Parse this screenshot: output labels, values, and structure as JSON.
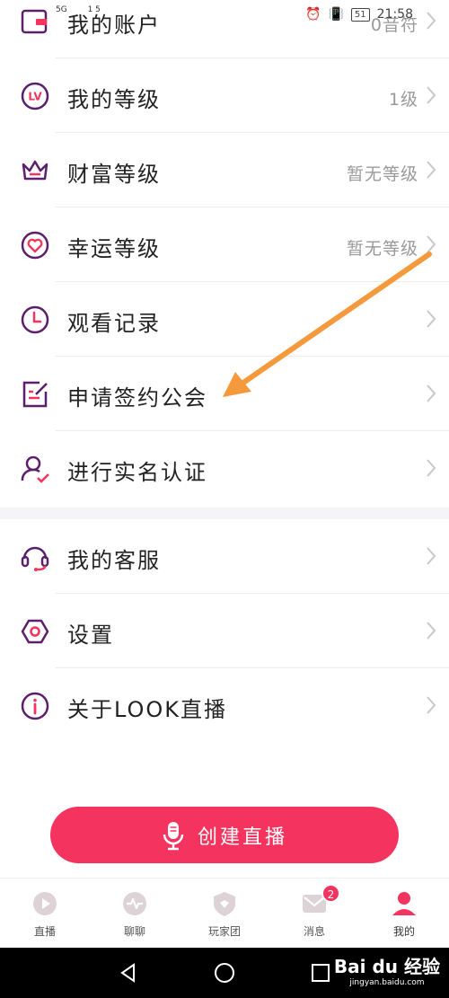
{
  "status_bar": {
    "signal": "5G",
    "data_speed": "1 5",
    "battery": "51",
    "time": "21:58"
  },
  "menu_group_1": [
    {
      "name": "account",
      "label": "我的账户",
      "value": "0音符",
      "icon": "wallet-icon"
    },
    {
      "name": "level",
      "label": "我的等级",
      "value": "1级",
      "icon": "lv-badge-icon"
    },
    {
      "name": "wealth-level",
      "label": "财富等级",
      "value": "暂无等级",
      "icon": "crown-icon"
    },
    {
      "name": "luck-level",
      "label": "幸运等级",
      "value": "暂无等级",
      "icon": "heart-circle-icon"
    },
    {
      "name": "watch-history",
      "label": "观看记录",
      "value": "",
      "icon": "clock-icon"
    },
    {
      "name": "apply-guild",
      "label": "申请签约公会",
      "value": "",
      "icon": "edit-document-icon"
    },
    {
      "name": "real-name",
      "label": "进行实名认证",
      "value": "",
      "icon": "user-verified-icon"
    }
  ],
  "menu_group_2": [
    {
      "name": "customer-service",
      "label": "我的客服",
      "value": "",
      "icon": "headset-icon"
    },
    {
      "name": "settings",
      "label": "设置",
      "value": "",
      "icon": "hexagon-settings-icon"
    },
    {
      "name": "about",
      "label": "关于LOOK直播",
      "value": "",
      "icon": "info-icon"
    }
  ],
  "create_button": {
    "label": "创建直播",
    "icon": "microphone-icon"
  },
  "tabs": [
    {
      "label": "直播",
      "icon": "play-icon",
      "active": false
    },
    {
      "label": "聊聊",
      "icon": "chat-pulse-icon",
      "active": false
    },
    {
      "label": "玩家团",
      "icon": "shield-icon",
      "active": false
    },
    {
      "label": "消息",
      "icon": "mail-icon",
      "active": false,
      "badge": "2"
    },
    {
      "label": "我的",
      "icon": "profile-icon",
      "active": true
    }
  ],
  "watermark": {
    "main": "Bai du 经验",
    "sub": "jingyan.baidu.com"
  },
  "colors": {
    "accent": "#f4335e",
    "icon_purple": "#5b1f6b",
    "value_gray": "#9a9a9a",
    "arrow": "#f59a3c"
  }
}
